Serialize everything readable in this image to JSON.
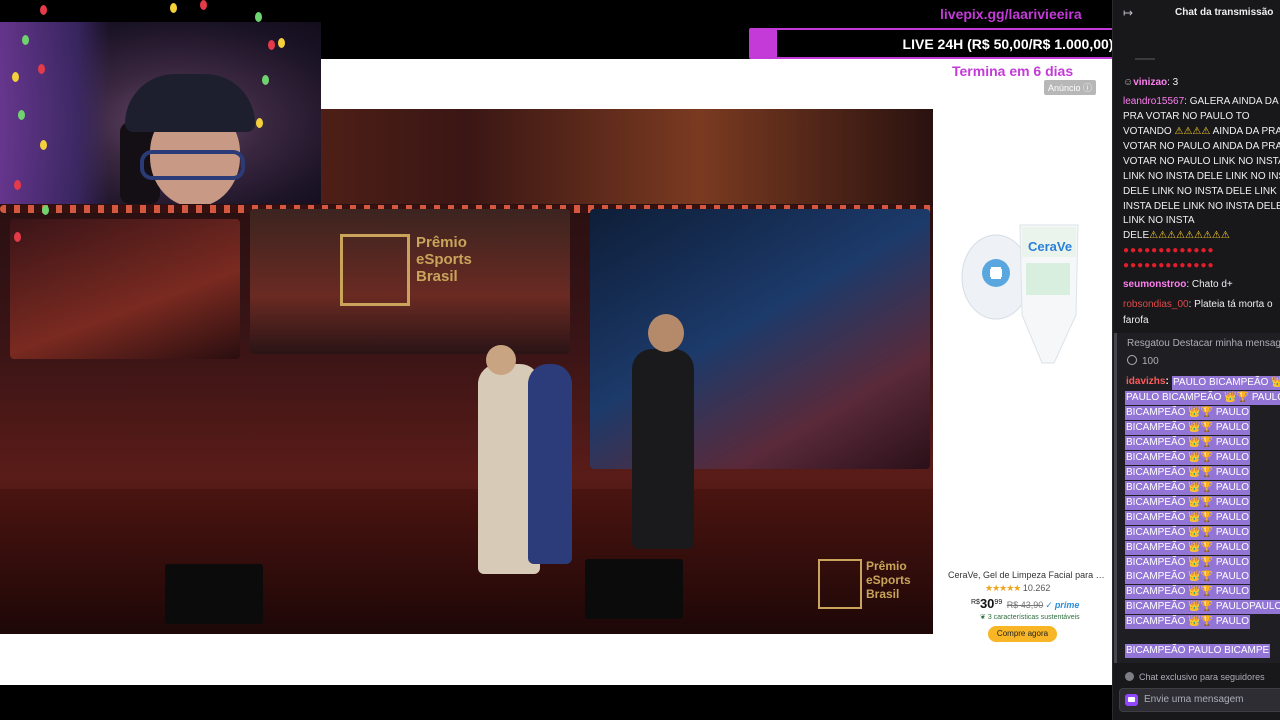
{
  "overlay": {
    "livepix_url": "livepix.gg/laarivieeira",
    "goal_label": "LIVE 24H (R$ 50,00/R$ 1.000,00)",
    "goal_progress": 0.05,
    "goal_ends": "Termina em 6 dias"
  },
  "video": {
    "brand_line1": "Prêmio",
    "brand_line2": "eSports",
    "brand_line3": "Brasil"
  },
  "ad": {
    "badge": "Anúncio",
    "product_title": "CeraVe, Gel de Limpeza Facial para pele...",
    "rating_count": "10.262",
    "currency": "R$",
    "price_main": "30",
    "price_cents": "99",
    "price_old": "R$ 43,90",
    "prime": "prime",
    "sustain": "3 características sustentáveis",
    "buy_label": "Compre agora"
  },
  "chat": {
    "title": "Chat da transmissão",
    "messages": [
      {
        "user": "vinizao",
        "user_color": "#ff7ff0",
        "lines": [
          ": 3"
        ]
      },
      {
        "user": "leandro15567",
        "user_color": "#ff7ff0",
        "lines": [
          ": GALERA AINDA DA",
          "PRA VOTAR NO PAULO TO",
          "VOTANDO",
          "AINDA DA PRA",
          "VOTAR NO PAULO AINDA DA PRA",
          "VOTAR NO PAULO LINK NO INSTA",
          "LINK NO INSTA DELE LINK NO INS",
          "DELE LINK NO INSTA DELE LINK N",
          "INSTA DELE LINK NO INSTA DELE",
          "LINK NO INSTA",
          "DELE"
        ]
      },
      {
        "user": "seumonstroo",
        "user_color": "#ff7ff0",
        "lines": [
          ": Chato d+"
        ]
      },
      {
        "user": "robsondias_00",
        "user_color": "#e04848",
        "lines": [
          ": Plateia tá morta o",
          "farofa"
        ]
      }
    ],
    "redeem_label": "Resgatou Destacar minha mensagem",
    "redeem_cost": "100",
    "highlight_user": "idavizhs",
    "highlight_user_color": "#ff5a5a",
    "highlight_lines": [
      "PAULO BICAMPEÃO 👑",
      "PAULO BICAMPEÃO 👑🏆 PAULO",
      "BICAMPEÃO 👑🏆 PAULO",
      "BICAMPEÃO 👑🏆 PAULO",
      "BICAMPEÃO 👑🏆 PAULO",
      "BICAMPEÃO 👑🏆 PAULO",
      "BICAMPEÃO 👑🏆 PAULO",
      "BICAMPEÃO 👑🏆 PAULO",
      "BICAMPEÃO 👑🏆 PAULO",
      "BICAMPEÃO 👑🏆 PAULO",
      "BICAMPEÃO 👑🏆 PAULO",
      "BICAMPEÃO 👑🏆 PAULO",
      "BICAMPEÃO 👑🏆 PAULO",
      "BICAMPEÃO 👑🏆 PAULO",
      "BICAMPEÃO 👑🏆 PAULO",
      "BICAMPEÃO 👑🏆 PAULOPAULO",
      "BICAMPEÃO 👑🏆 PAULO",
      "BICAMPEÃO PAULO BICAMPE"
    ],
    "followers_only": "Chat exclusivo para seguidores",
    "input_placeholder": "Envie uma mensagem"
  }
}
